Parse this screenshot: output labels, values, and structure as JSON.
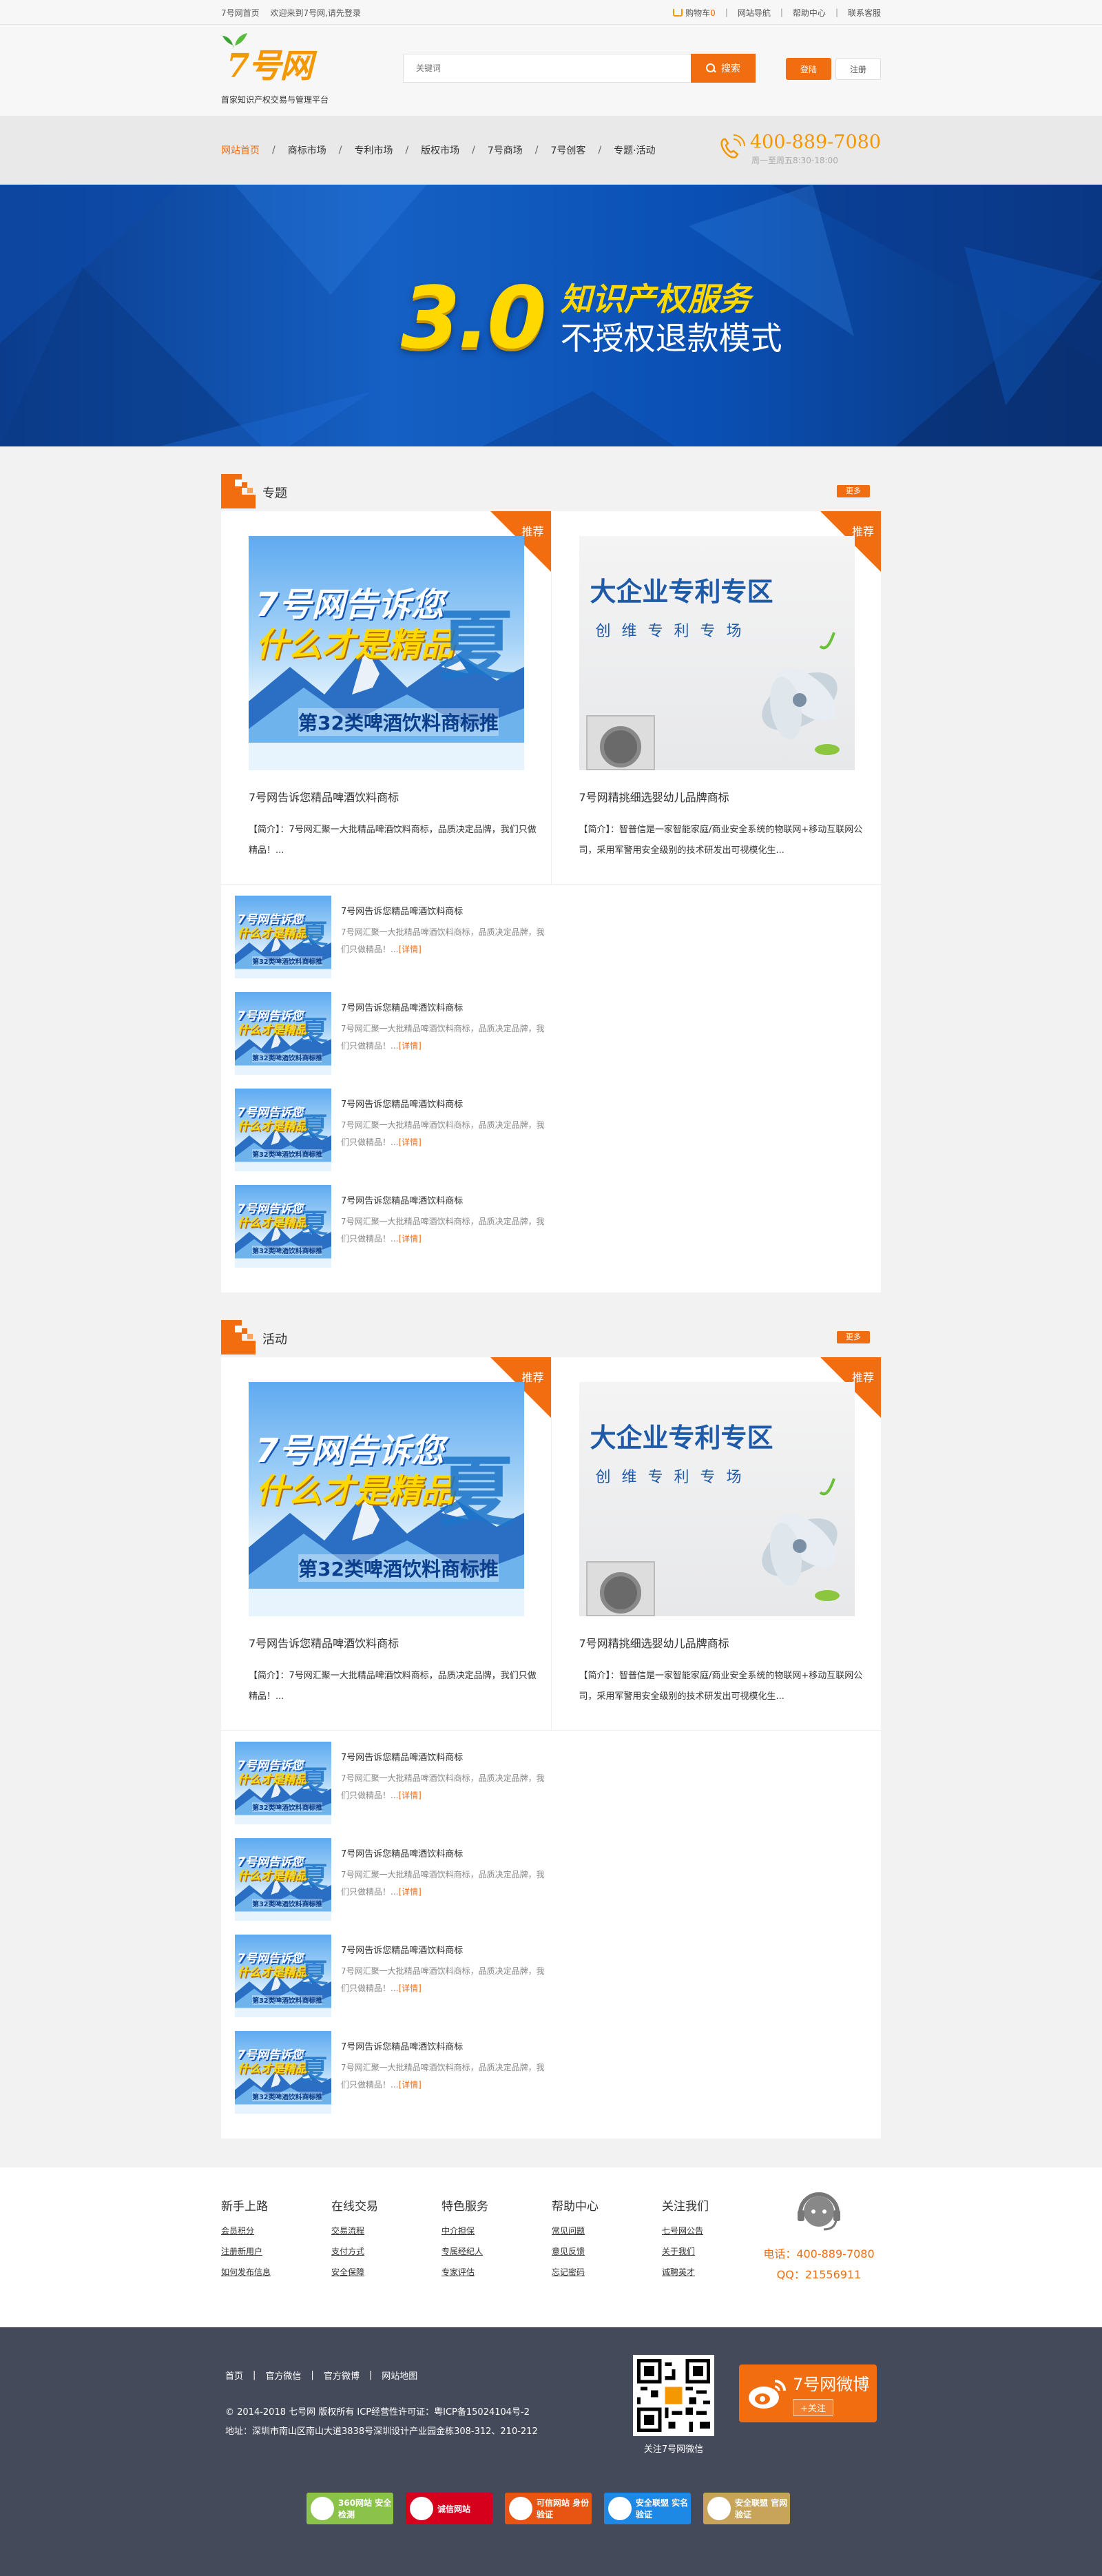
{
  "topbar": {
    "home": "7号网首页",
    "welcome": "欢迎来到7号网,请先登录",
    "cart_label": "购物车",
    "cart_count": "0",
    "site_nav": "网站导航",
    "help": "帮助中心",
    "contact": "联系客服"
  },
  "header": {
    "logo_text": "7号网",
    "logo_sub": "首家知识产权交易与管理平台",
    "search_placeholder": "关键词",
    "search_button": "搜索",
    "login": "登陆",
    "register": "注册"
  },
  "nav": {
    "items": [
      "网站首页",
      "商标市场",
      "专利市场",
      "版权市场",
      "7号商场",
      "7号创客",
      "专题·活动"
    ],
    "phone": "400-889-7080",
    "hours": "周一至周五8:30-18:00"
  },
  "banner": {
    "version": "3.0",
    "line1": "知识产权服务",
    "line2": "不授权退款模式"
  },
  "picA": {
    "l1": "7号网告诉您",
    "l2": "什么才是精品",
    "xia": "夏",
    "l3": "第32类啤酒饮料商标推"
  },
  "picB": {
    "p1": "大企业专利专区",
    "p2": "创维专利专场"
  },
  "sections": [
    {
      "title": "专题",
      "more": "更多",
      "features": [
        {
          "badge": "推荐",
          "title": "7号网告诉您精品啤酒饮料商标",
          "desc": "【简介】：7号网汇聚一大批精品啤酒饮料商标，品质决定品牌，我们只做精品！..."
        },
        {
          "badge": "推荐",
          "title": "7号网精挑细选婴幼儿品牌商标",
          "desc": "【简介】：智普信是一家智能家庭/商业安全系统的物联网+移动互联网公司，采用军警用安全级别的技术研发出可视模化生..."
        }
      ],
      "minis": [
        {
          "title": "7号网告诉您精品啤酒饮料商标",
          "desc": "7号网汇聚一大批精品啤酒饮料商标，品质决定品牌，我们只做精品！...",
          "detail": "[详情]"
        },
        {
          "title": "7号网告诉您精品啤酒饮料商标",
          "desc": "7号网汇聚一大批精品啤酒饮料商标，品质决定品牌，我们只做精品！...",
          "detail": "[详情]"
        },
        {
          "title": "7号网告诉您精品啤酒饮料商标",
          "desc": "7号网汇聚一大批精品啤酒饮料商标，品质决定品牌，我们只做精品！...",
          "detail": "[详情]"
        },
        {
          "title": "7号网告诉您精品啤酒饮料商标",
          "desc": "7号网汇聚一大批精品啤酒饮料商标，品质决定品牌，我们只做精品！...",
          "detail": "[详情]"
        }
      ]
    },
    {
      "title": "活动",
      "more": "更多",
      "features": [
        {
          "badge": "推荐",
          "title": "7号网告诉您精品啤酒饮料商标",
          "desc": "【简介】：7号网汇聚一大批精品啤酒饮料商标，品质决定品牌，我们只做精品！..."
        },
        {
          "badge": "推荐",
          "title": "7号网精挑细选婴幼儿品牌商标",
          "desc": "【简介】：智普信是一家智能家庭/商业安全系统的物联网+移动互联网公司，采用军警用安全级别的技术研发出可视模化生..."
        }
      ],
      "minis": [
        {
          "title": "7号网告诉您精品啤酒饮料商标",
          "desc": "7号网汇聚一大批精品啤酒饮料商标，品质决定品牌，我们只做精品！...",
          "detail": "[详情]"
        },
        {
          "title": "7号网告诉您精品啤酒饮料商标",
          "desc": "7号网汇聚一大批精品啤酒饮料商标，品质决定品牌，我们只做精品！...",
          "detail": "[详情]"
        },
        {
          "title": "7号网告诉您精品啤酒饮料商标",
          "desc": "7号网汇聚一大批精品啤酒饮料商标，品质决定品牌，我们只做精品！...",
          "detail": "[详情]"
        },
        {
          "title": "7号网告诉您精品啤酒饮料商标",
          "desc": "7号网汇聚一大批精品啤酒饮料商标，品质决定品牌，我们只做精品！...",
          "detail": "[详情]"
        }
      ]
    }
  ],
  "footer": {
    "columns": [
      {
        "title": "新手上路",
        "links": [
          "会员积分",
          "注册新用户",
          "如何发布信息"
        ]
      },
      {
        "title": "在线交易",
        "links": [
          "交易流程",
          "支付方式",
          "安全保障"
        ]
      },
      {
        "title": "特色服务",
        "links": [
          "中介担保",
          "专属经纪人",
          "专家评估"
        ]
      },
      {
        "title": "帮助中心",
        "links": [
          "常见问题",
          "意见反馈",
          "忘记密码"
        ]
      },
      {
        "title": "关注我们",
        "links": [
          "七号网公告",
          "关于我们",
          "诚聘英才"
        ]
      }
    ],
    "tel": "电话：400-889-7080",
    "qq": "QQ：21556911"
  },
  "bottom": {
    "links": [
      "首页",
      "官方微信",
      "官方微博",
      "网站地图"
    ],
    "copyright": "© 2014-2018 七号网 版权所有 ICP经营性许可证：粤ICP备15024104号-2",
    "address": "地址：深圳市南山区南山大道3838号深圳设计产业园金栋308-312、210-212",
    "qr_caption": "关注7号网微信",
    "weibo_title": "7号网微博",
    "weibo_follow": "+关注",
    "badges": [
      {
        "label": "360网站 安全检测",
        "color": "#8bc34a"
      },
      {
        "label": "诚信网站",
        "color": "#d6001c"
      },
      {
        "label": "可信网站 身份验证",
        "color": "#e85412"
      },
      {
        "label": "安全联盟 实名验证",
        "color": "#1e88e5"
      },
      {
        "label": "安全联盟 官网验证",
        "color": "#c8a35a"
      }
    ]
  },
  "colors": {
    "accent": "#f26d0f",
    "gold": "#f39800",
    "banner_blue": "#1560c4",
    "footer_bg": "#454a5a"
  }
}
